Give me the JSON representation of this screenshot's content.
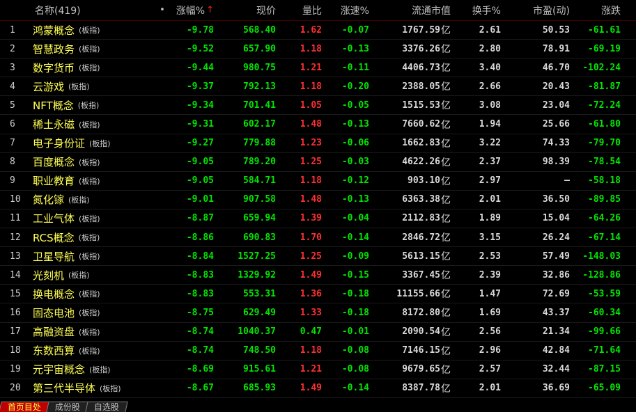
{
  "header": {
    "name_label": "名称(419)",
    "dot": "•",
    "chg_label": "涨幅%",
    "sort_arrow": "↑",
    "price_label": "现价",
    "ratio_label": "量比",
    "speed_label": "涨速%",
    "cap_label": "流通市值",
    "turn_label": "换手%",
    "pe_label": "市盈(动)",
    "diff_label": "涨跌"
  },
  "rows": [
    {
      "idx": "1",
      "name": "鸿蒙概念",
      "tag": "(板指)",
      "chg": "-9.78",
      "price": "568.40",
      "ratio": "1.62",
      "speed": "-0.07",
      "cap": "1767.59",
      "unit": "亿",
      "turn": "2.61",
      "pe": "50.53",
      "diff": "-61.61"
    },
    {
      "idx": "2",
      "name": "智慧政务",
      "tag": "(板指)",
      "chg": "-9.52",
      "price": "657.90",
      "ratio": "1.18",
      "speed": "-0.13",
      "cap": "3376.26",
      "unit": "亿",
      "turn": "2.80",
      "pe": "78.91",
      "diff": "-69.19"
    },
    {
      "idx": "3",
      "name": "数字货币",
      "tag": "(板指)",
      "chg": "-9.44",
      "price": "980.75",
      "ratio": "1.21",
      "speed": "-0.11",
      "cap": "4406.73",
      "unit": "亿",
      "turn": "3.40",
      "pe": "46.70",
      "diff": "-102.24"
    },
    {
      "idx": "4",
      "name": "云游戏",
      "tag": "(板指)",
      "chg": "-9.37",
      "price": "792.13",
      "ratio": "1.18",
      "speed": "-0.20",
      "cap": "2388.05",
      "unit": "亿",
      "turn": "2.66",
      "pe": "20.43",
      "diff": "-81.87"
    },
    {
      "idx": "5",
      "name": "NFT概念",
      "tag": "(板指)",
      "chg": "-9.34",
      "price": "701.41",
      "ratio": "1.05",
      "speed": "-0.05",
      "cap": "1515.53",
      "unit": "亿",
      "turn": "3.08",
      "pe": "23.04",
      "diff": "-72.24"
    },
    {
      "idx": "6",
      "name": "稀土永磁",
      "tag": "(板指)",
      "chg": "-9.31",
      "price": "602.17",
      "ratio": "1.48",
      "speed": "-0.13",
      "cap": "7660.62",
      "unit": "亿",
      "turn": "1.94",
      "pe": "25.66",
      "diff": "-61.80"
    },
    {
      "idx": "7",
      "name": "电子身份证",
      "tag": "(板指)",
      "chg": "-9.27",
      "price": "779.88",
      "ratio": "1.23",
      "speed": "-0.06",
      "cap": "1662.83",
      "unit": "亿",
      "turn": "3.22",
      "pe": "74.33",
      "diff": "-79.70"
    },
    {
      "idx": "8",
      "name": "百度概念",
      "tag": "(板指)",
      "chg": "-9.05",
      "price": "789.20",
      "ratio": "1.25",
      "speed": "-0.03",
      "cap": "4622.26",
      "unit": "亿",
      "turn": "2.37",
      "pe": "98.39",
      "diff": "-78.54"
    },
    {
      "idx": "9",
      "name": "职业教育",
      "tag": "(板指)",
      "chg": "-9.05",
      "price": "584.71",
      "ratio": "1.18",
      "speed": "-0.12",
      "cap": "903.10",
      "unit": "亿",
      "turn": "2.97",
      "pe": "—",
      "diff": "-58.18"
    },
    {
      "idx": "10",
      "name": "氮化镓",
      "tag": "(板指)",
      "chg": "-9.01",
      "price": "907.58",
      "ratio": "1.48",
      "speed": "-0.13",
      "cap": "6363.38",
      "unit": "亿",
      "turn": "2.01",
      "pe": "36.50",
      "diff": "-89.85"
    },
    {
      "idx": "11",
      "name": "工业气体",
      "tag": "(板指)",
      "chg": "-8.87",
      "price": "659.94",
      "ratio": "1.39",
      "speed": "-0.04",
      "cap": "2112.83",
      "unit": "亿",
      "turn": "1.89",
      "pe": "15.04",
      "diff": "-64.26"
    },
    {
      "idx": "12",
      "name": "RCS概念",
      "tag": "(板指)",
      "chg": "-8.86",
      "price": "690.83",
      "ratio": "1.70",
      "speed": "-0.14",
      "cap": "2846.72",
      "unit": "亿",
      "turn": "3.15",
      "pe": "26.24",
      "diff": "-67.14"
    },
    {
      "idx": "13",
      "name": "卫星导航",
      "tag": "(板指)",
      "chg": "-8.84",
      "price": "1527.25",
      "ratio": "1.25",
      "speed": "-0.09",
      "cap": "5613.15",
      "unit": "亿",
      "turn": "2.53",
      "pe": "57.49",
      "diff": "-148.03"
    },
    {
      "idx": "14",
      "name": "光刻机",
      "tag": "(板指)",
      "chg": "-8.83",
      "price": "1329.92",
      "ratio": "1.49",
      "speed": "-0.15",
      "cap": "3367.45",
      "unit": "亿",
      "turn": "2.39",
      "pe": "32.86",
      "diff": "-128.86"
    },
    {
      "idx": "15",
      "name": "换电概念",
      "tag": "(板指)",
      "chg": "-8.83",
      "price": "553.31",
      "ratio": "1.36",
      "speed": "-0.18",
      "cap": "11155.66",
      "unit": "亿",
      "turn": "1.47",
      "pe": "72.69",
      "diff": "-53.59"
    },
    {
      "idx": "16",
      "name": "固态电池",
      "tag": "(板指)",
      "chg": "-8.75",
      "price": "629.49",
      "ratio": "1.33",
      "speed": "-0.18",
      "cap": "8172.80",
      "unit": "亿",
      "turn": "1.69",
      "pe": "43.37",
      "diff": "-60.34"
    },
    {
      "idx": "17",
      "name": "高融资盘",
      "tag": "(板指)",
      "chg": "-8.74",
      "price": "1040.37",
      "ratio": "0.47",
      "speed": "-0.01",
      "cap": "2090.54",
      "unit": "亿",
      "turn": "2.56",
      "pe": "21.34",
      "diff": "-99.66"
    },
    {
      "idx": "18",
      "name": "东数西算",
      "tag": "(板指)",
      "chg": "-8.74",
      "price": "748.50",
      "ratio": "1.18",
      "speed": "-0.08",
      "cap": "7146.15",
      "unit": "亿",
      "turn": "2.96",
      "pe": "42.84",
      "diff": "-71.64"
    },
    {
      "idx": "19",
      "name": "元宇宙概念",
      "tag": "(板指)",
      "chg": "-8.69",
      "price": "915.61",
      "ratio": "1.21",
      "speed": "-0.08",
      "cap": "9679.65",
      "unit": "亿",
      "turn": "2.57",
      "pe": "32.44",
      "diff": "-87.15"
    },
    {
      "idx": "20",
      "name": "第三代半导体",
      "tag": "(板指)",
      "chg": "-8.67",
      "price": "685.93",
      "ratio": "1.49",
      "speed": "-0.14",
      "cap": "8387.78",
      "unit": "亿",
      "turn": "2.01",
      "pe": "36.69",
      "diff": "-65.09"
    }
  ],
  "tabs": [
    "首页目处",
    "成份股",
    "自选股"
  ],
  "colors": {
    "background": "#000000",
    "name": "#ffff54",
    "down": "#00e600",
    "up": "#ff3030",
    "text": "#c0c0c0"
  }
}
